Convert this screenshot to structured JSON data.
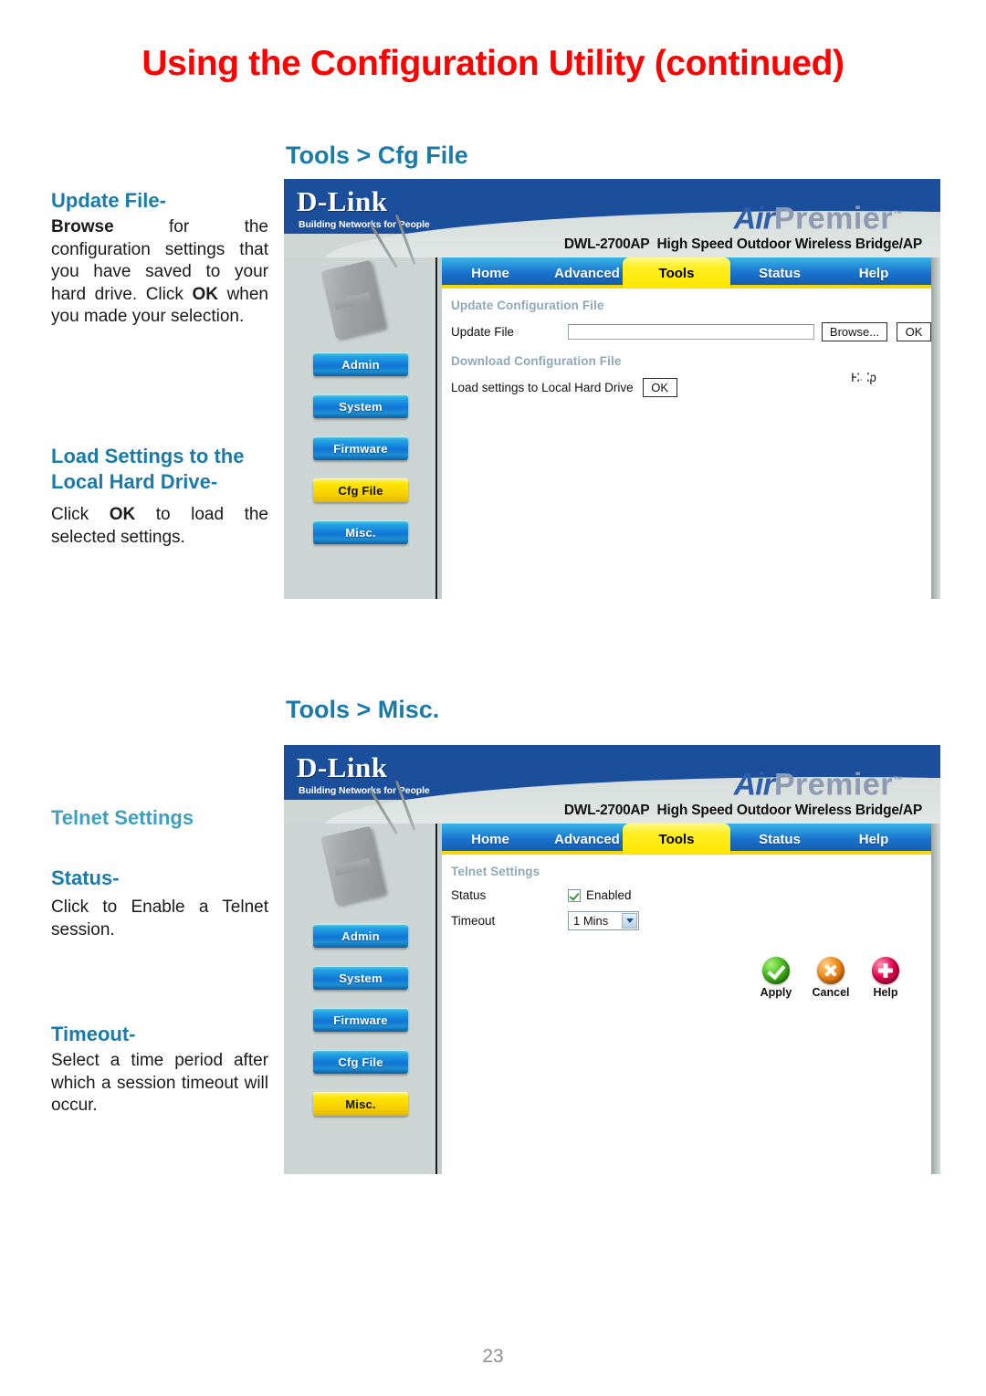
{
  "page": {
    "title": "Using the Configuration Utility (continued)",
    "number": "23",
    "accent_heading": "#1a7ba8",
    "title_color": "#ff0000"
  },
  "sections": [
    {
      "heading": "Tools > Cfg File",
      "left_blocks": [
        {
          "head": "Update File-",
          "body": "Browse for the configuration settings that you have saved to your hard drive. Click OK when you made your selection.",
          "bold_words": [
            "Browse",
            "OK"
          ]
        },
        {
          "head": "Load Settings to the Local Hard Drive-",
          "body": "Click OK to load the selected settings.",
          "bold_words": [
            "OK"
          ]
        }
      ],
      "window": {
        "brand": "D-Link",
        "brand_tagline": "Building Networks for People",
        "product_line": "Air",
        "product_line2": "Premier",
        "trademark": "™",
        "model": "DWL-2700AP",
        "model_desc": "High Speed Outdoor Wireless Bridge/AP",
        "tabs": [
          {
            "label": "Home",
            "selected": false
          },
          {
            "label": "Advanced",
            "selected": false
          },
          {
            "label": "Tools",
            "selected": true
          },
          {
            "label": "Status",
            "selected": false
          },
          {
            "label": "Help",
            "selected": false
          }
        ],
        "menu": [
          {
            "label": "Admin",
            "active": false
          },
          {
            "label": "System",
            "active": false
          },
          {
            "label": "Firmware",
            "active": false
          },
          {
            "label": "Cfg File",
            "active": true
          },
          {
            "label": "Misc.",
            "active": false
          }
        ],
        "pane": {
          "group1_label": "Update Configuration File",
          "update_file_label": "Update File",
          "update_file_value": "",
          "browse_button": "Browse...",
          "ok_button": "OK",
          "group2_label": "Download Configuration File",
          "download_label": "Load settings to Local Hard Drive",
          "download_ok_button": "OK"
        },
        "actions": [
          {
            "label": "Help",
            "icon": "help-plus-icon",
            "color": "#e4004d"
          }
        ]
      }
    },
    {
      "heading": "Tools > Misc.",
      "left_blocks": [
        {
          "head": "Telnet Settings",
          "body": "",
          "light": true
        },
        {
          "head": "Status-",
          "body": "Click to Enable a Telnet session."
        },
        {
          "head": "Timeout-",
          "body": "Select a time period after which a session timeout will occur."
        }
      ],
      "window": {
        "brand": "D-Link",
        "brand_tagline": "Building Networks for People",
        "product_line": "Air",
        "product_line2": "Premier",
        "trademark": "™",
        "model": "DWL-2700AP",
        "model_desc": "High Speed Outdoor Wireless Bridge/AP",
        "tabs": [
          {
            "label": "Home",
            "selected": false
          },
          {
            "label": "Advanced",
            "selected": false
          },
          {
            "label": "Tools",
            "selected": true
          },
          {
            "label": "Status",
            "selected": false
          },
          {
            "label": "Help",
            "selected": false
          }
        ],
        "menu": [
          {
            "label": "Admin",
            "active": false
          },
          {
            "label": "System",
            "active": false
          },
          {
            "label": "Firmware",
            "active": false
          },
          {
            "label": "Cfg File",
            "active": false
          },
          {
            "label": "Misc.",
            "active": true
          }
        ],
        "pane": {
          "group1_label": "Telnet Settings",
          "status_label": "Status",
          "status_checkbox_checked": true,
          "status_checkbox_label": "Enabled",
          "timeout_label": "Timeout",
          "timeout_value": "1 Mins"
        },
        "actions": [
          {
            "label": "Apply",
            "icon": "apply-check-icon",
            "color": "#43bb18"
          },
          {
            "label": "Cancel",
            "icon": "cancel-x-icon",
            "color": "#f18a19"
          },
          {
            "label": "Help",
            "icon": "help-plus-icon",
            "color": "#e4004d"
          }
        ]
      }
    }
  ]
}
